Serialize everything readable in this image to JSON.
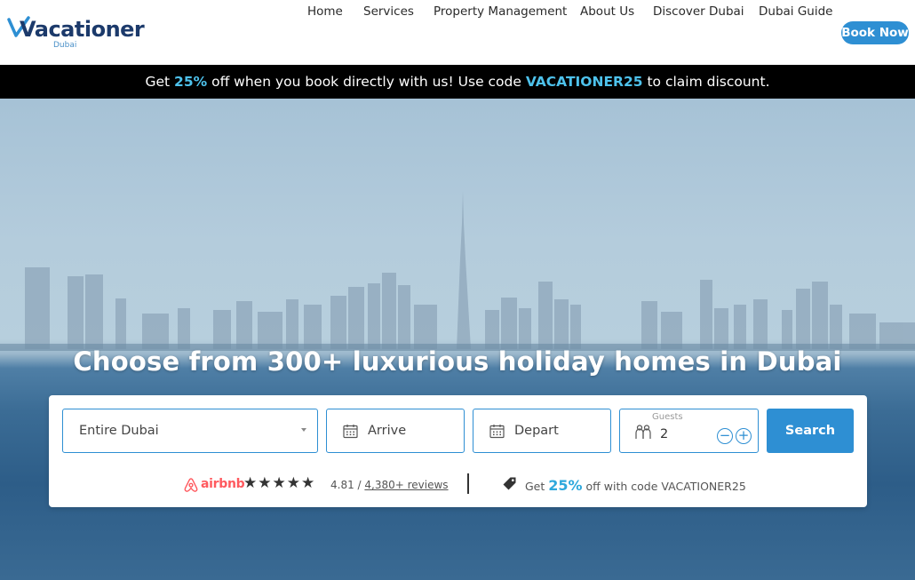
{
  "brand": {
    "name": "Vacationer",
    "sub": "Dubai"
  },
  "nav": {
    "items": [
      "Home",
      "Services",
      "Property Management",
      "About Us",
      "Discover Dubai",
      "Dubai Guide"
    ],
    "cta": "Book Now"
  },
  "promo": {
    "pre": "Get ",
    "pct": "25%",
    "mid": " off when you book directly with us! Use code ",
    "code": "VACATIONER25",
    "post": " to claim discount."
  },
  "hero": {
    "title": "Choose from 300+ luxurious holiday homes in Dubai"
  },
  "search": {
    "location": "Entire Dubai",
    "arrive": "Arrive",
    "depart": "Depart",
    "guests_label": "Guests",
    "guests_value": "2",
    "minus": "−",
    "plus": "+",
    "button": "Search"
  },
  "reviews": {
    "brand": "airbnb",
    "stars": "★★★★★",
    "score": "4.81 / ",
    "reviews_link": "4,380+ reviews"
  },
  "offer": {
    "pre": "Get ",
    "pct": "25%",
    "post": " off with code VACATIONER25"
  },
  "colors": {
    "accent": "#2e8fd3",
    "highlight": "#4ec2ec",
    "airbnb": "#ff5a5f",
    "brand_dark": "#1c3a6b"
  }
}
